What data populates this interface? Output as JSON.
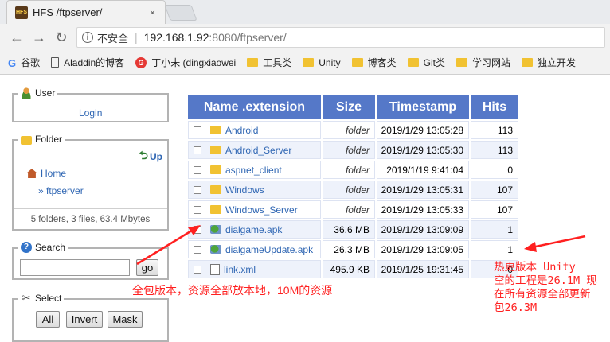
{
  "browser": {
    "tab_title": "HFS /ftpserver/",
    "favicon_text": "HFS",
    "close_glyph": "×",
    "omnibox": {
      "insecure_label": "不安全",
      "host": "192.168.1.92",
      "rest": ":8080/ftpserver/"
    },
    "bookmarks": [
      {
        "icon": "google-icon",
        "label": "谷歌"
      },
      {
        "icon": "doc-icon",
        "label": "Aladdin的博客"
      },
      {
        "icon": "red-g-icon",
        "label": "丁小未 (dingxiaowei"
      },
      {
        "icon": "folder-icon",
        "label": "工具类"
      },
      {
        "icon": "folder-icon",
        "label": "Unity"
      },
      {
        "icon": "folder-icon",
        "label": "博客类"
      },
      {
        "icon": "folder-icon",
        "label": "Git类"
      },
      {
        "icon": "folder-icon",
        "label": "学习网站"
      },
      {
        "icon": "folder-icon",
        "label": "独立开发"
      }
    ]
  },
  "sidebar": {
    "user": {
      "legend": "User",
      "login": "Login"
    },
    "folder": {
      "legend": "Folder",
      "up": "Up",
      "home": "Home",
      "current": "» ftpserver",
      "summary": "5 folders, 3 files, 63.4 Mbytes"
    },
    "search": {
      "legend": "Search",
      "go": "go"
    },
    "select": {
      "legend": "Select",
      "all": "All",
      "invert": "Invert",
      "mask": "Mask"
    }
  },
  "files": {
    "headers": {
      "name": "Name .extension",
      "size": "Size",
      "timestamp": "Timestamp",
      "hits": "Hits"
    },
    "rows": [
      {
        "name": "Android",
        "type": "folder",
        "size": "folder",
        "timestamp": "2019/1/29 13:05:28",
        "hits": "113"
      },
      {
        "name": "Android_Server",
        "type": "folder",
        "size": "folder",
        "timestamp": "2019/1/29 13:05:30",
        "hits": "113"
      },
      {
        "name": "aspnet_client",
        "type": "folder",
        "size": "folder",
        "timestamp": "2019/1/19 9:41:04",
        "hits": "0"
      },
      {
        "name": "Windows",
        "type": "folder",
        "size": "folder",
        "timestamp": "2019/1/29 13:05:31",
        "hits": "107"
      },
      {
        "name": "Windows_Server",
        "type": "folder",
        "size": "folder",
        "timestamp": "2019/1/29 13:05:33",
        "hits": "107"
      },
      {
        "name": "dialgame.apk",
        "type": "apk",
        "size": "36.6 MB",
        "timestamp": "2019/1/29 13:09:09",
        "hits": "1"
      },
      {
        "name": "dialgameUpdate.apk",
        "type": "apk",
        "size": "26.3 MB",
        "timestamp": "2019/1/29 13:09:05",
        "hits": "1"
      },
      {
        "name": "link.xml",
        "type": "xml",
        "size": "495.9 KB",
        "timestamp": "2019/1/25 19:31:45",
        "hits": "0"
      }
    ]
  },
  "annotations": {
    "full_package": "全包版本，资源全部放本地，10M的资源",
    "hot_update": [
      "热更版本 Unity",
      "空的工程是26.1M 现",
      "在所有资源全部更新",
      "包26.3M"
    ]
  },
  "colors": {
    "header_bg": "#5578c8",
    "link": "#2f66b3",
    "annotation": "#ff2020"
  }
}
